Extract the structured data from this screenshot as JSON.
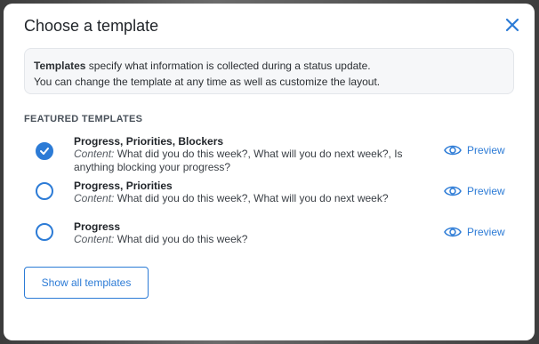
{
  "modal": {
    "title": "Choose a template",
    "close_icon": "close-icon",
    "accent_color": "#2c7bd6"
  },
  "info": {
    "bold": "Templates",
    "line1_rest": " specify what information is collected during a status update.",
    "line2": "You can change the template at any time as well as customize the layout."
  },
  "section_title": "FEATURED TEMPLATES",
  "templates": [
    {
      "name": "Progress, Priorities, Blockers",
      "content_label": "Content:",
      "content": " What did you do this week?, What will you do next week?, Is anything blocking your progress?",
      "selected": true,
      "preview_label": "Preview"
    },
    {
      "name": "Progress, Priorities",
      "content_label": "Content:",
      "content": " What did you do this week?, What will you do next week?",
      "selected": false,
      "preview_label": "Preview"
    },
    {
      "name": "Progress",
      "content_label": "Content:",
      "content": " What did you do this week?",
      "selected": false,
      "preview_label": "Preview"
    }
  ],
  "show_all_button": "Show all templates"
}
